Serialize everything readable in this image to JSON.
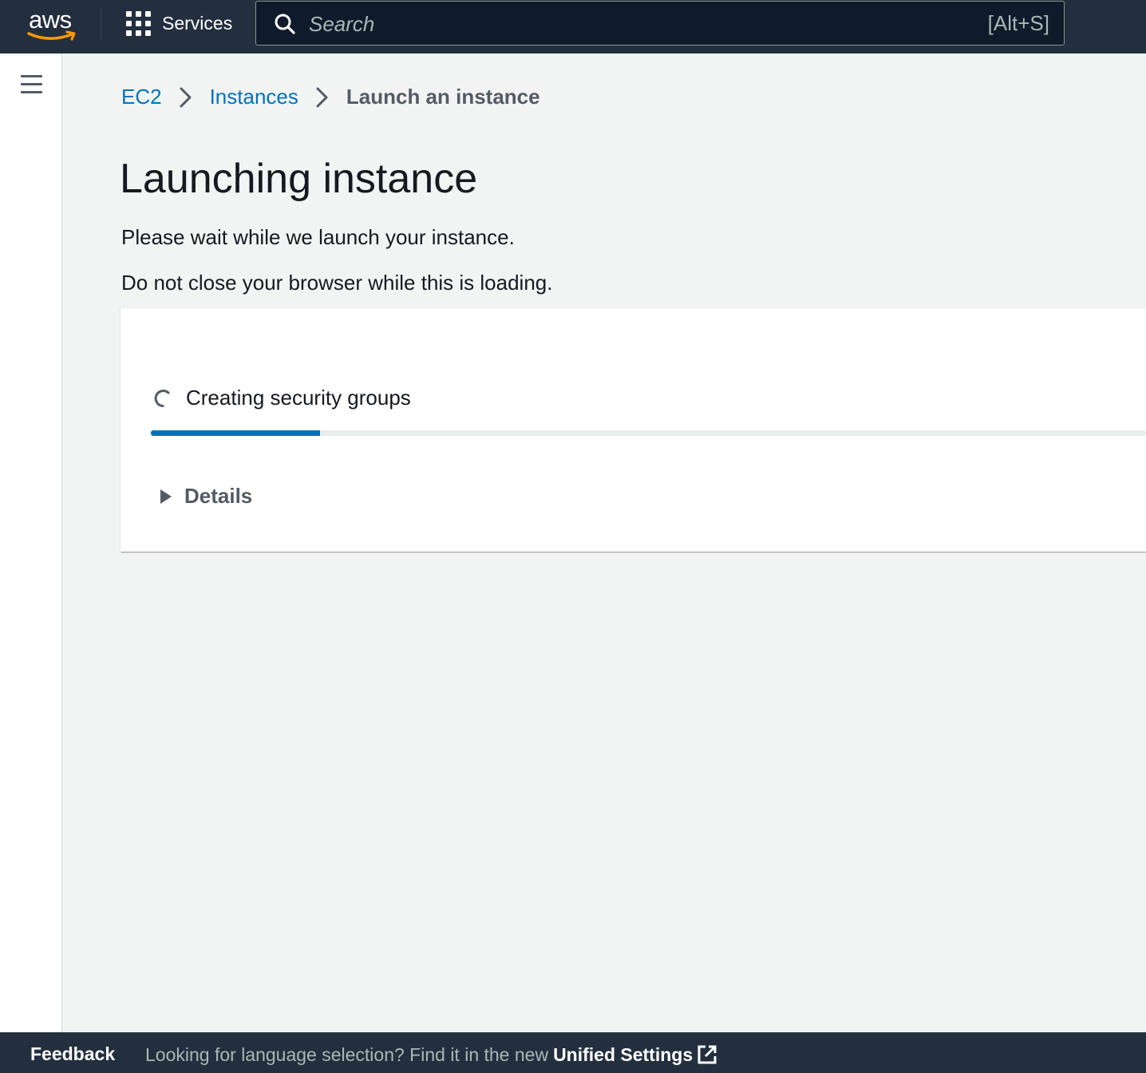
{
  "nav": {
    "logo_text": "aws",
    "services_label": "Services",
    "search_placeholder": "Search",
    "search_shortcut": "[Alt+S]"
  },
  "breadcrumb": {
    "items": [
      {
        "label": "EC2"
      },
      {
        "label": "Instances"
      },
      {
        "label": "Launch an instance"
      }
    ]
  },
  "main": {
    "title": "Launching instance",
    "subtitle_1": "Please wait while we launch your instance.",
    "subtitle_2": "Do not close your browser while this is loading."
  },
  "progress": {
    "status_text": "Creating security groups",
    "percent": 17,
    "details_label": "Details"
  },
  "footer": {
    "feedback_label": "Feedback",
    "language_message": "Looking for language selection? Find it in the new",
    "unified_settings_label": "Unified Settings"
  },
  "colors": {
    "nav_bg": "#232f3e",
    "link": "#0073bb",
    "progress_fill": "#0073bb",
    "aws_orange": "#ff9900"
  }
}
